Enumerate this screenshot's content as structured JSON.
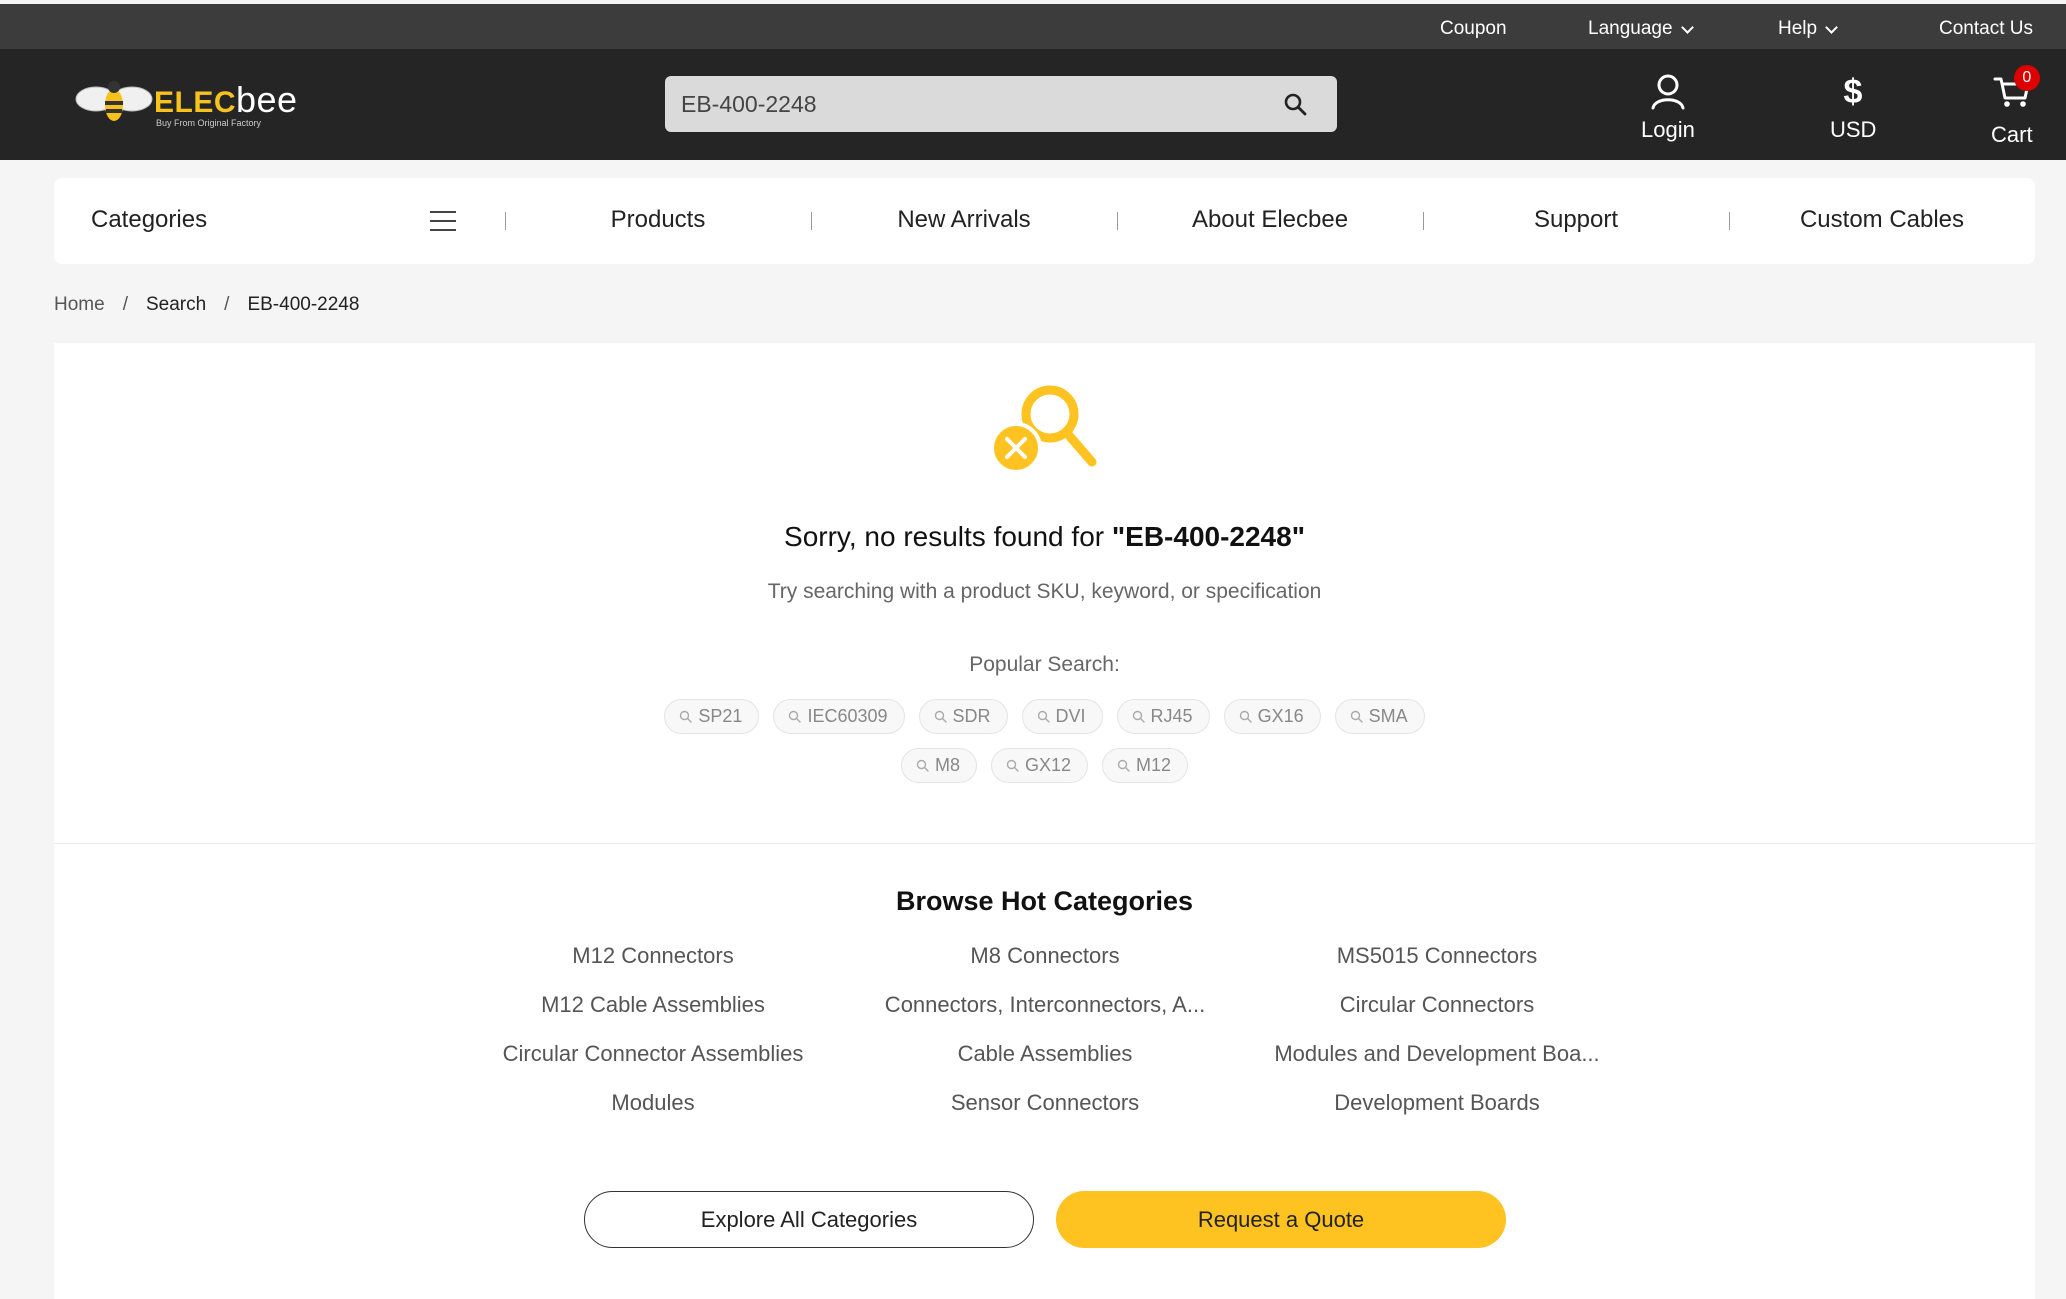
{
  "topbar": {
    "coupon": "Coupon",
    "language": "Language",
    "help": "Help",
    "contact": "Contact Us"
  },
  "header": {
    "logo_brand_prefix": "ELEC",
    "logo_brand_suffix": "bee",
    "logo_tagline": "Buy From Original Factory",
    "search_value": "EB-400-2248",
    "login_label": "Login",
    "currency_label": "USD",
    "currency_symbol": "$",
    "cart_label": "Cart",
    "cart_count": "0"
  },
  "nav": {
    "categories": "Categories",
    "items": [
      "Products",
      "New Arrivals",
      "About Elecbee",
      "Support",
      "Custom Cables"
    ]
  },
  "breadcrumb": {
    "home": "Home",
    "search": "Search",
    "current": "EB-400-2248",
    "separator": "/"
  },
  "results": {
    "message_prefix": "Sorry, no results found for ",
    "query": "\"EB-400-2248\"",
    "hint": "Try searching with a product SKU, keyword, or specification",
    "popular_label": "Popular Search:",
    "popular_row1": [
      "SP21",
      "IEC60309",
      "SDR",
      "DVI",
      "RJ45",
      "GX16",
      "SMA"
    ],
    "popular_row2": [
      "M8",
      "GX12",
      "M12"
    ]
  },
  "hot_categories": {
    "title": "Browse Hot Categories",
    "items": [
      "M12 Connectors",
      "M8 Connectors",
      "MS5015 Connectors",
      "M12 Cable Assemblies",
      "Connectors, Interconnectors, A...",
      "Circular Connectors",
      "Circular Connector Assemblies",
      "Cable Assemblies",
      "Modules and Development Boa...",
      "Modules",
      "Sensor Connectors",
      "Development Boards"
    ]
  },
  "actions": {
    "explore": "Explore All Categories",
    "quote": "Request a Quote"
  },
  "colors": {
    "brand_yellow": "#fec320",
    "header_dark": "#252525",
    "topbar_dark": "#3c3c3c",
    "badge_red": "#dd0000"
  }
}
